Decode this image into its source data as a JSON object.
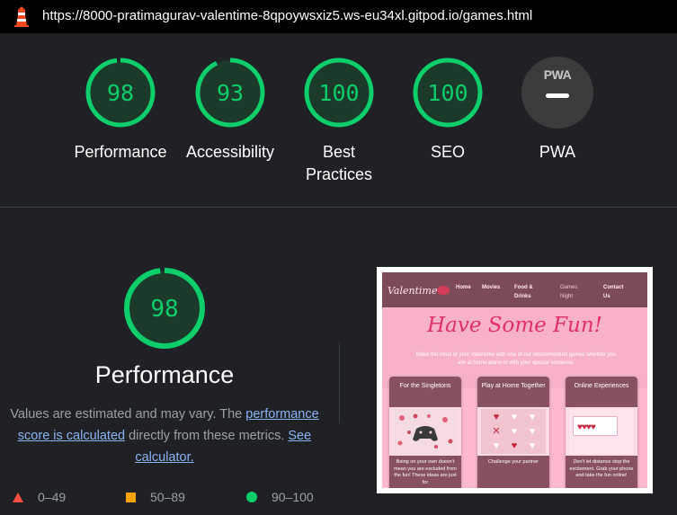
{
  "topbar": {
    "url": "https://8000-pratimagurav-valentime-8qpoywsxiz5.ws-eu34xl.gitpod.io/games.html"
  },
  "colors": {
    "pass": "#0cce6b",
    "average": "#ffa400",
    "fail": "#ff4e42",
    "background": "#202124"
  },
  "scores": [
    {
      "label": "Performance",
      "value": "98",
      "fraction": 0.98
    },
    {
      "label": "Accessibility",
      "value": "93",
      "fraction": 0.93
    },
    {
      "label": "Best Practices",
      "value": "100",
      "fraction": 1.0
    },
    {
      "label": "SEO",
      "value": "100",
      "fraction": 1.0
    },
    {
      "label": "PWA",
      "badge": "PWA"
    }
  ],
  "performance": {
    "score": "98",
    "fraction": 0.98,
    "title": "Performance",
    "desc_before": "Values are estimated and may vary. The ",
    "desc_link": "performance score is calculated",
    "desc_middle": " directly from these metrics. ",
    "desc_calc_link": "See calculator."
  },
  "legend": [
    {
      "range": "0–49",
      "shape": "triangle"
    },
    {
      "range": "50–89",
      "shape": "square"
    },
    {
      "range": "90–100",
      "shape": "circle"
    }
  ],
  "screenshot": {
    "brand": "Valentime",
    "nav": [
      "Home",
      "Movies",
      "Food & Drinks",
      "Games Night",
      "Contact Us"
    ],
    "hero_title": "Have Some Fun!",
    "intro": "Make the most of your Valentime with one of our recommended games whether you are at home alone or with your special someone.",
    "cards": [
      {
        "title": "For the Singletons",
        "body": "Being on your own doesn't mean you are excluded from the fun! These ideas are just for"
      },
      {
        "title": "Play at Home Together",
        "body": "Challenge your partner"
      },
      {
        "title": "Online Experiences",
        "body": "Don't let distance stop the excitement. Grab your phone and take the fun online!"
      }
    ]
  }
}
